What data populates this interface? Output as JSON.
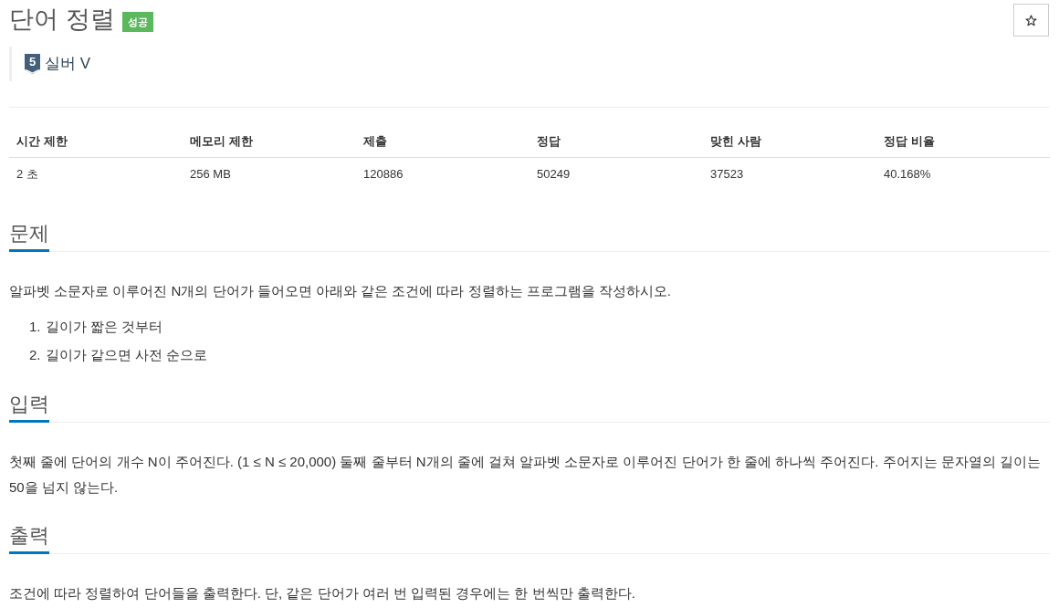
{
  "title": "단어 정렬",
  "result_badge": "성공",
  "starred": false,
  "tier": {
    "number": "5",
    "name": "실버 V"
  },
  "stats_table": {
    "columns": [
      "시간 제한",
      "메모리 제한",
      "제출",
      "정답",
      "맞힌 사람",
      "정답 비율"
    ],
    "rows": [
      [
        "2 초",
        "256 MB",
        "120886",
        "50249",
        "37523",
        "40.168%"
      ]
    ]
  },
  "sections": [
    {
      "heading": "문제",
      "body": [
        {
          "kind": "paragraph",
          "text": "알파벳 소문자로 이루어진 N개의 단어가 들어오면 아래와 같은 조건에 따라 정렬하는 프로그램을 작성하시오."
        },
        {
          "kind": "list",
          "items": [
            {
              "marker": "1.",
              "text": "길이가 짧은 것부터"
            },
            {
              "marker": "2.",
              "text": "길이가 같으면 사전 순으로"
            }
          ]
        }
      ]
    },
    {
      "heading": "입력",
      "body": [
        {
          "kind": "paragraph",
          "text": "첫째 줄에 단어의 개수 N이 주어진다. (1 ≤ N ≤ 20,000) 둘째 줄부터 N개의 줄에 걸쳐 알파벳 소문자로 이루어진 단어가 한 줄에 하나씩 주어진다. 주어지는 문자열의 길이는 50을 넘지 않는다."
        }
      ]
    },
    {
      "heading": "출력",
      "body": [
        {
          "kind": "paragraph",
          "text": "조건에 따라 정렬하여 단어들을 출력한다. 단, 같은 단어가 여러 번 입력된 경우에는 한 번씩만 출력한다."
        }
      ]
    }
  ]
}
